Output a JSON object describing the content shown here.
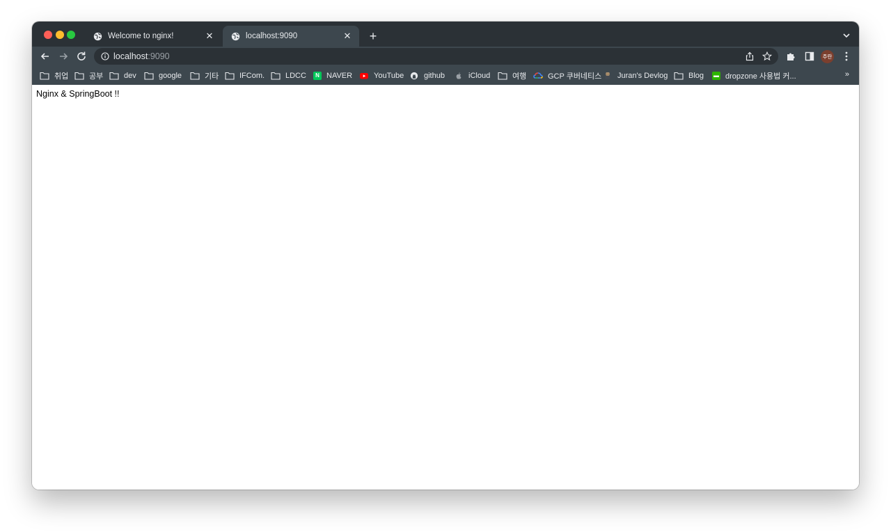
{
  "browser": {
    "tabs": [
      {
        "title": "Welcome to nginx!",
        "active": false
      },
      {
        "title": "localhost:9090",
        "active": true
      }
    ],
    "new_tab_label": "+",
    "address": {
      "host": "localhost",
      "port": ":9090"
    },
    "profile_initials": "주란",
    "overflow_label": "»"
  },
  "bookmarks": [
    {
      "label": "취업",
      "icon": "folder-icon"
    },
    {
      "label": "공부",
      "icon": "folder-icon"
    },
    {
      "label": "dev",
      "icon": "folder-icon"
    },
    {
      "label": "google",
      "icon": "folder-icon"
    },
    {
      "label": "기타",
      "icon": "folder-icon"
    },
    {
      "label": "IFCom.",
      "icon": "folder-icon"
    },
    {
      "label": "LDCC",
      "icon": "folder-icon"
    },
    {
      "label": "NAVER",
      "icon": "naver-icon"
    },
    {
      "label": "YouTube",
      "icon": "youtube-icon"
    },
    {
      "label": "github",
      "icon": "github-icon"
    },
    {
      "label": "iCloud",
      "icon": "apple-icon"
    },
    {
      "label": "여행",
      "icon": "folder-icon"
    },
    {
      "label": "GCP 쿠버네티스",
      "icon": "gcp-icon"
    },
    {
      "label": "Juran's Devlog",
      "icon": "devlog-icon"
    },
    {
      "label": "Blog",
      "icon": "folder-icon"
    },
    {
      "label": "dropzone 사용법 커...",
      "icon": "chat-icon"
    }
  ],
  "page": {
    "body_text": "Nginx & SpringBoot !!"
  },
  "colors": {
    "tabstrip": "#2b3136",
    "toolbar": "#3d474e",
    "omnibox": "#2b3136",
    "naver": "#03c75a",
    "youtube": "#ff0000"
  }
}
